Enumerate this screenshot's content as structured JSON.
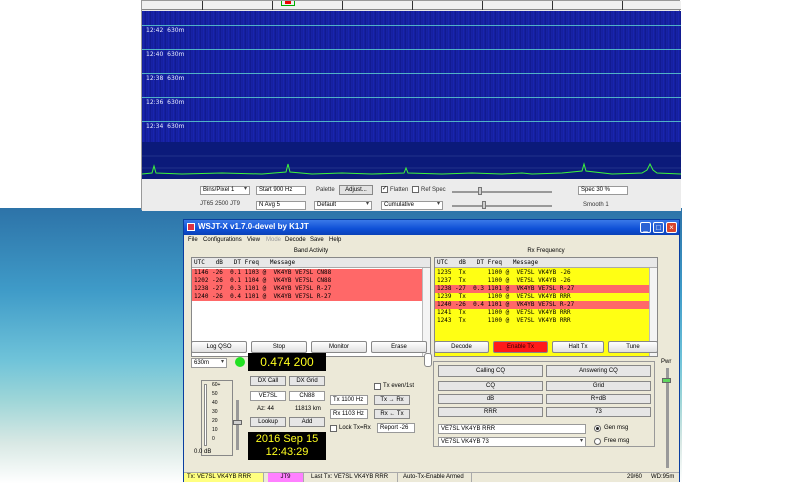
{
  "waterfall": {
    "time_labels": [
      {
        "time": "12:42",
        "band": "630m"
      },
      {
        "time": "12:40",
        "band": "630m"
      },
      {
        "time": "12:38",
        "band": "630m"
      },
      {
        "time": "12:36",
        "band": "630m"
      },
      {
        "time": "12:34",
        "band": "630m"
      }
    ],
    "bins_per_pixel": "Bins/Pixel 1",
    "start": "Start 900 Hz",
    "n_avg": "N Avg 5",
    "jt_line": "JT65 2500 JT9",
    "palette_label": "Palette",
    "adjust_label": "Adjust...",
    "palette_value": "Default",
    "flatten_label": "Flatten",
    "flatten_checked": true,
    "ref_spec_label": "Ref Spec",
    "ref_spec_checked": false,
    "mode_value": "Cumulative",
    "spec_value": "Spec 30 %",
    "smooth_value": "Smooth 1"
  },
  "app": {
    "title": "WSJT-X   v1.7.0-devel   by K1JT",
    "menu": [
      "File",
      "Configurations",
      "View",
      "Mode",
      "Decode",
      "Save",
      "Help"
    ],
    "band_activity_title": "Band Activity",
    "rx_frequency_title": "Rx Frequency",
    "band_header": "UTC   dB   DT Freq   Message",
    "rx_header": "UTC   dB   DT Freq   Message",
    "band_rows": [
      {
        "text": "1146 -26  0.1 1103 @  VK4YB VE7SL CN88",
        "color": "red"
      },
      {
        "text": "1202 -26  0.1 1104 @  VK4YB VE7SL CN88",
        "color": "red"
      },
      {
        "text": "1238 -27  0.3 1101 @  VK4YB VE7SL R-27",
        "color": "red"
      },
      {
        "text": "1240 -26  0.4 1101 @  VK4YB VE7SL R-27",
        "color": "red"
      }
    ],
    "rx_rows": [
      {
        "text": "1235  Tx      1100 @  VE7SL VK4YB -26",
        "color": "yel"
      },
      {
        "text": "1237  Tx      1100 @  VE7SL VK4YB -26",
        "color": "yel"
      },
      {
        "text": "1238 -27  0.3 1101 @  VK4YB VE7SL R-27",
        "color": "red"
      },
      {
        "text": "1239  Tx      1100 @  VE7SL VK4YB RRR",
        "color": "yel"
      },
      {
        "text": "1240 -26  0.4 1101 @  VK4YB VE7SL R-27",
        "color": "red"
      },
      {
        "text": "1241  Tx      1100 @  VE7SL VK4YB RRR",
        "color": "yel"
      },
      {
        "text": "1243  Tx      1100 @  VE7SL VK4YB RRR",
        "color": "yel"
      }
    ],
    "buttons": {
      "log_qso": "Log QSO",
      "stop": "Stop",
      "monitor": "Monitor",
      "erase": "Erase",
      "decode": "Decode",
      "enable_tx": "Enable Tx",
      "halt_tx": "Halt Tx",
      "tune": "Tune"
    },
    "band_select": "630m",
    "frequency": "0.474 200",
    "meter_scale": [
      "60+",
      "50",
      "40",
      "30",
      "20",
      "10",
      "0"
    ],
    "meter_value": "0.0 dB",
    "dx_call_label": "DX Call",
    "dx_grid_label": "DX Grid",
    "dx_call": "VE7SL",
    "dx_grid": "CN88",
    "az": "Az: 44",
    "distance": "11813 km",
    "lookup_label": "Lookup",
    "add_label": "Add",
    "date": "2016 Sep 15",
    "time": "12:43:29",
    "tx_even_label": "Tx even/1st",
    "tx_freq": "Tx  1100 Hz",
    "rx_freq": "Rx  1103 Hz",
    "tx_to_rx": "Tx → Rx",
    "rx_to_tx": "Rx ← Tx",
    "lock_label": "Lock Tx=Rx",
    "report": "Report -26",
    "calling_cq_title": "Calling CQ",
    "answering_cq_title": "Answering CQ",
    "cq_buttons": [
      "CQ",
      "dB",
      "RRR"
    ],
    "ans_buttons": [
      "Grid",
      "R+dB",
      "73"
    ],
    "gen_msg_text": "VE7SL VK4YB RRR",
    "free_msg_text": "VE7SL VK4YB 73",
    "gen_msg_label": "Gen msg",
    "free_msg_label": "Free msg",
    "pwr_label": "Pwr",
    "status_tx": "Tx: VE7SL VK4YB RRR",
    "status_mode": "JT9",
    "status_last": "Last Tx: VE7SL VK4YB RRR",
    "status_auto": "Auto-Tx-Enable Armed",
    "status_count": "29/60",
    "status_wd": "WD:95m"
  },
  "colors": {
    "waterfall_bg": "#1b27b4",
    "band_highlight": "#ff6868",
    "rx_highlight": "#ffff14",
    "enable_tx": "#ff1a1a",
    "freq_text": "#ffff20",
    "status_tx_bg": "#ffff80",
    "status_mode_bg": "#ff80ff"
  }
}
